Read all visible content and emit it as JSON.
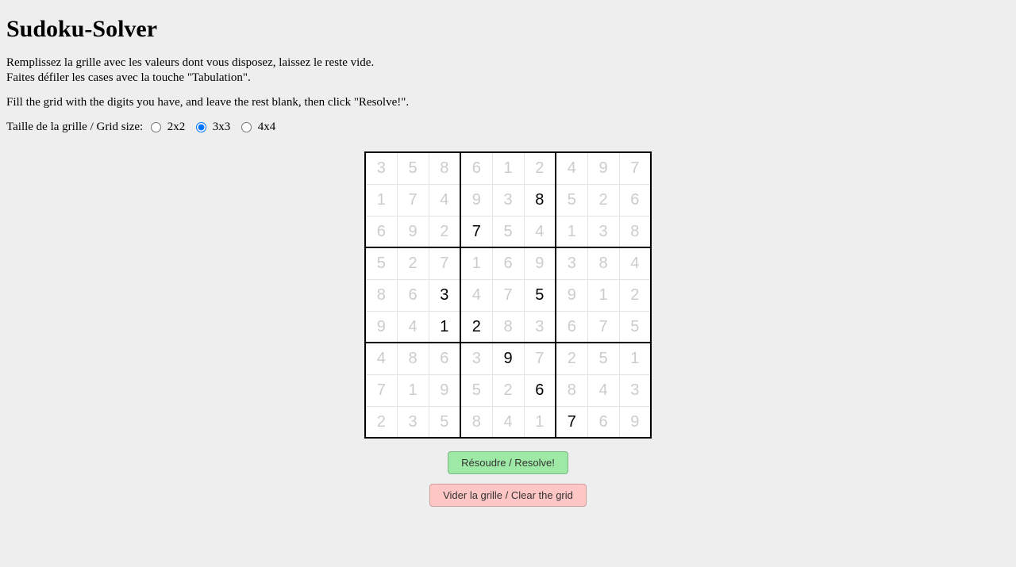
{
  "title": "Sudoku-Solver",
  "instructions_fr_line1": "Remplissez la grille avec les valeurs dont vous disposez, laissez le reste vide.",
  "instructions_fr_line2": "Faites défiler les cases avec la touche \"Tabulation\".",
  "instructions_en": "Fill the grid with the digits you have, and leave the rest blank, then click \"Resolve!\".",
  "size_label": "Taille de la grille / Grid size:",
  "size_options": {
    "opt2": "2x2",
    "opt3": "3x3",
    "opt4": "4x4"
  },
  "size_selected": "3x3",
  "buttons": {
    "resolve": "Résoudre / Resolve!",
    "clear": "Vider la grille / Clear the grid"
  },
  "grid": {
    "placeholders": [
      [
        "3",
        "5",
        "8",
        "6",
        "1",
        "2",
        "4",
        "9",
        "7"
      ],
      [
        "1",
        "7",
        "4",
        "9",
        "3",
        "8",
        "5",
        "2",
        "6"
      ],
      [
        "6",
        "9",
        "2",
        "7",
        "5",
        "4",
        "1",
        "3",
        "8"
      ],
      [
        "5",
        "2",
        "7",
        "1",
        "6",
        "9",
        "3",
        "8",
        "4"
      ],
      [
        "8",
        "6",
        "3",
        "4",
        "7",
        "5",
        "9",
        "1",
        "2"
      ],
      [
        "9",
        "4",
        "1",
        "2",
        "8",
        "3",
        "6",
        "7",
        "5"
      ],
      [
        "4",
        "8",
        "6",
        "3",
        "9",
        "7",
        "2",
        "5",
        "1"
      ],
      [
        "7",
        "1",
        "9",
        "5",
        "2",
        "6",
        "8",
        "4",
        "3"
      ],
      [
        "2",
        "3",
        "5",
        "8",
        "4",
        "1",
        "7",
        "6",
        "9"
      ]
    ],
    "values": [
      [
        "",
        "",
        "",
        "",
        "",
        "",
        "",
        "",
        ""
      ],
      [
        "",
        "",
        "",
        "",
        "",
        "8",
        "",
        "",
        ""
      ],
      [
        "",
        "",
        "",
        "7",
        "",
        "",
        "",
        "",
        ""
      ],
      [
        "",
        "",
        "",
        "",
        "",
        "",
        "",
        "",
        ""
      ],
      [
        "",
        "",
        "3",
        "",
        "",
        "5",
        "",
        "",
        ""
      ],
      [
        "",
        "",
        "1",
        "2",
        "",
        "",
        "",
        "",
        ""
      ],
      [
        "",
        "",
        "",
        "",
        "9",
        "",
        "",
        "",
        ""
      ],
      [
        "",
        "",
        "",
        "",
        "",
        "6",
        "",
        "",
        ""
      ],
      [
        "",
        "",
        "",
        "",
        "",
        "",
        "7",
        "",
        ""
      ]
    ]
  }
}
